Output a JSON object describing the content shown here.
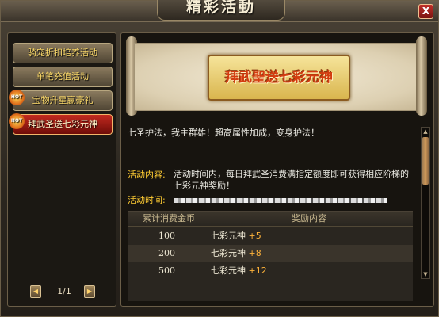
{
  "window": {
    "title": "精彩活動",
    "close_label": "X"
  },
  "sidebar": {
    "items": [
      {
        "label": "骑宠折扣培养活动",
        "hot": false,
        "active": false
      },
      {
        "label": "单笔充值活动",
        "hot": false,
        "active": false
      },
      {
        "label": "宝物升星赢豪礼",
        "hot": true,
        "active": false
      },
      {
        "label": "拜武圣送七彩元神",
        "hot": true,
        "active": true
      }
    ],
    "hot_badge_text": "HOT",
    "pager": {
      "prev": "◀",
      "next": "▶",
      "text": "1/1"
    }
  },
  "banner": {
    "title": "拜武聖送七彩元神"
  },
  "details": {
    "intro": "七圣护法，我主群雄！超高属性加成，变身护法！",
    "content_label": "活动内容:",
    "content_text": "活动时间内，每日拜武圣消费满指定额度即可获得相应阶梯的七彩元神奖励！",
    "time_label": "活动时间:"
  },
  "reward_table": {
    "headers": [
      "累计消费金币",
      "奖励内容"
    ],
    "rows": [
      {
        "amount": "100",
        "item": "七彩元神",
        "qty": "+5"
      },
      {
        "amount": "200",
        "item": "七彩元神",
        "qty": "+8"
      },
      {
        "amount": "500",
        "item": "七彩元神",
        "qty": "+12"
      }
    ]
  },
  "scrollbar": {
    "up": "▲",
    "down": "▼"
  }
}
